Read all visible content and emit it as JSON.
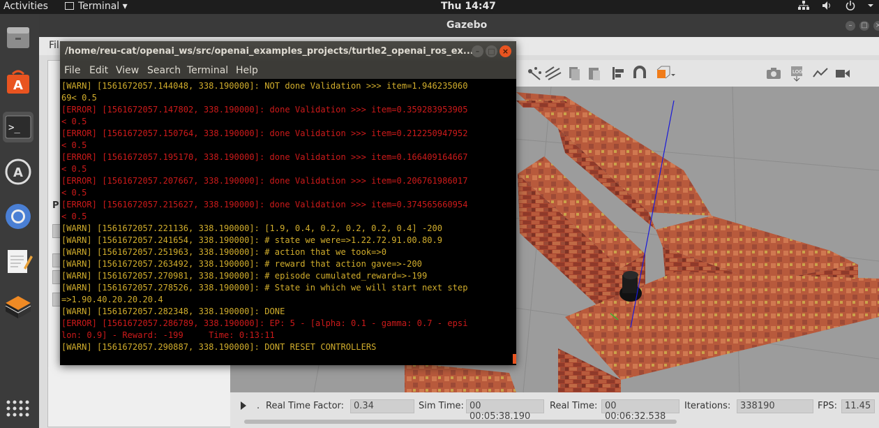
{
  "topbar": {
    "activities": "Activities",
    "app_menu": "Terminal ▾",
    "clock": "Thu 14:47",
    "tray_icons": [
      "network-icon",
      "volume-icon",
      "power-icon"
    ],
    "tray_text": "⛭ 🔊 ⏻ ▾"
  },
  "dock": {
    "items": [
      "files-icon",
      "software-center-icon",
      "terminal-icon",
      "software-updater-icon",
      "chromium-icon",
      "text-editor-icon",
      "package-icon"
    ],
    "app_grid": "apps-grid-icon"
  },
  "gazebo": {
    "title": "Gazebo",
    "menu_file": "Fil",
    "left_panel_tab": "P",
    "toolbar_icons": [
      "translate-icon",
      "scale-icon",
      "copy-icon",
      "paste-icon",
      "align-icon",
      "magnet-icon",
      "view-angle-icon",
      "screenshot-icon",
      "log-icon",
      "plot-icon",
      "record-video-icon"
    ],
    "status": {
      "rtf_label": "Real Time Factor:",
      "rtf_value": "0.34",
      "sim_label": "Sim Time:",
      "sim_value": "00 00:05:38.190",
      "real_label": "Real Time:",
      "real_value": "00 00:06:32.538",
      "iter_label": "Iterations:",
      "iter_value": "338190",
      "fps_label": "FPS:",
      "fps_value": "11.45"
    }
  },
  "terminal": {
    "title": "/home/reu-cat/openai_ws/src/openai_examples_projects/turtle2_openai_ros_ex...",
    "menu": [
      "File",
      "Edit",
      "View",
      "Search",
      "Terminal",
      "Help"
    ],
    "lines": [
      {
        "level": "warn",
        "text": "[WARN] [1561672057.144048, 338.190000]: NOT done Validation >>> item=1.946235060"
      },
      {
        "level": "warn",
        "text": "69< 0.5"
      },
      {
        "level": "error",
        "text": "[ERROR] [1561672057.147802, 338.190000]: done Validation >>> item=0.359283953905"
      },
      {
        "level": "error",
        "text": "< 0.5"
      },
      {
        "level": "error",
        "text": "[ERROR] [1561672057.150764, 338.190000]: done Validation >>> item=0.212250947952"
      },
      {
        "level": "error",
        "text": "< 0.5"
      },
      {
        "level": "error",
        "text": "[ERROR] [1561672057.195170, 338.190000]: done Validation >>> item=0.166409164667"
      },
      {
        "level": "error",
        "text": "< 0.5"
      },
      {
        "level": "error",
        "text": "[ERROR] [1561672057.207667, 338.190000]: done Validation >>> item=0.206761986017"
      },
      {
        "level": "error",
        "text": "< 0.5"
      },
      {
        "level": "error",
        "text": "[ERROR] [1561672057.215627, 338.190000]: done Validation >>> item=0.374565660954"
      },
      {
        "level": "error",
        "text": "< 0.5"
      },
      {
        "level": "warn",
        "text": "[WARN] [1561672057.221136, 338.190000]: [1.9, 0.4, 0.2, 0.2, 0.2, 0.4] -200"
      },
      {
        "level": "warn",
        "text": "[WARN] [1561672057.241654, 338.190000]: # state we were=>1.22.72.91.00.80.9"
      },
      {
        "level": "warn",
        "text": "[WARN] [1561672057.251963, 338.190000]: # action that we took=>0"
      },
      {
        "level": "warn",
        "text": "[WARN] [1561672057.263492, 338.190000]: # reward that action gave=>-200"
      },
      {
        "level": "warn",
        "text": "[WARN] [1561672057.270981, 338.190000]: # episode cumulated_reward=>-199"
      },
      {
        "level": "warn",
        "text": "[WARN] [1561672057.278526, 338.190000]: # State in which we will start next step"
      },
      {
        "level": "warn",
        "text": "=>1.90.40.20.20.20.4"
      },
      {
        "level": "warn",
        "text": "[WARN] [1561672057.282348, 338.190000]: DONE"
      },
      {
        "level": "error",
        "text": "[ERROR] [1561672057.286789, 338.190000]: EP: 5 - [alpha: 0.1 - gamma: 0.7 - epsi"
      },
      {
        "level": "error",
        "text": "lon: 0.9] - Reward: -199     Time: 0:13:11"
      },
      {
        "level": "warn",
        "text": "[WARN] [1561672057.290887, 338.190000]: DONT RESET CONTROLLERS"
      }
    ]
  }
}
